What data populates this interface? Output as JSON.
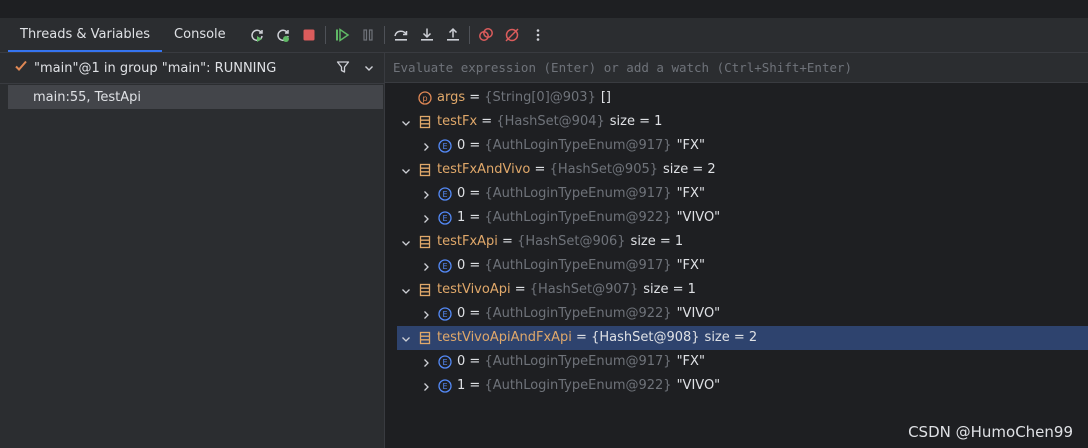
{
  "tabs": [
    {
      "label": "Threads & Variables",
      "active": true
    },
    {
      "label": "Console",
      "active": false
    }
  ],
  "toolbar_icons": [
    "rerun-icon",
    "restart-icon",
    "stop-icon",
    "resume-icon",
    "pause-icon",
    "step-over-icon",
    "step-into-icon",
    "step-out-icon",
    "view-breakpoints-icon",
    "mute-breakpoints-icon",
    "more-icon"
  ],
  "thread": {
    "status_icon": "checkmark-icon",
    "label": "\"main\"@1 in group \"main\": RUNNING"
  },
  "frame": {
    "label": "main:55, TestApi"
  },
  "evaluate": {
    "placeholder": "Evaluate expression (Enter) or add a watch (Ctrl+Shift+Enter)"
  },
  "colors": {
    "accent": "#3574f0",
    "selection": "#2e436e",
    "var_name": "#e0a86a",
    "ref": "#6f737a",
    "stop": "#db5c5c",
    "resume": "#5fb865"
  },
  "variables": [
    {
      "level": 0,
      "expand": "none",
      "icon": "parameter-icon",
      "name": "args",
      "eq": " = ",
      "ref": "{String[0]@903}",
      "value": "[]",
      "size": ""
    },
    {
      "level": 0,
      "expand": "expanded",
      "icon": "field-icon",
      "name": "testFx",
      "eq": " = ",
      "ref": "{HashSet@904}",
      "value": "",
      "size": "size = 1"
    },
    {
      "level": 1,
      "expand": "collapsed",
      "icon": "enum-icon",
      "name": "0",
      "eq": " = ",
      "ref": "{AuthLoginTypeEnum@917}",
      "value": "\"FX\"",
      "size": ""
    },
    {
      "level": 0,
      "expand": "expanded",
      "icon": "field-icon",
      "name": "testFxAndVivo",
      "eq": " = ",
      "ref": "{HashSet@905}",
      "value": "",
      "size": "size = 2"
    },
    {
      "level": 1,
      "expand": "collapsed",
      "icon": "enum-icon",
      "name": "0",
      "eq": " = ",
      "ref": "{AuthLoginTypeEnum@917}",
      "value": "\"FX\"",
      "size": ""
    },
    {
      "level": 1,
      "expand": "collapsed",
      "icon": "enum-icon",
      "name": "1",
      "eq": " = ",
      "ref": "{AuthLoginTypeEnum@922}",
      "value": "\"VIVO\"",
      "size": ""
    },
    {
      "level": 0,
      "expand": "expanded",
      "icon": "field-icon",
      "name": "testFxApi",
      "eq": " = ",
      "ref": "{HashSet@906}",
      "value": "",
      "size": "size = 1"
    },
    {
      "level": 1,
      "expand": "collapsed",
      "icon": "enum-icon",
      "name": "0",
      "eq": " = ",
      "ref": "{AuthLoginTypeEnum@917}",
      "value": "\"FX\"",
      "size": ""
    },
    {
      "level": 0,
      "expand": "expanded",
      "icon": "field-icon",
      "name": "testVivoApi",
      "eq": " = ",
      "ref": "{HashSet@907}",
      "value": "",
      "size": "size = 1"
    },
    {
      "level": 1,
      "expand": "collapsed",
      "icon": "enum-icon",
      "name": "0",
      "eq": " = ",
      "ref": "{AuthLoginTypeEnum@922}",
      "value": "\"VIVO\"",
      "size": ""
    },
    {
      "level": 0,
      "expand": "expanded",
      "icon": "field-icon",
      "name": "testVivoApiAndFxApi",
      "eq": " = ",
      "ref": "{HashSet@908}",
      "value": "",
      "size": "size = 2",
      "selected": true
    },
    {
      "level": 1,
      "expand": "collapsed",
      "icon": "enum-icon",
      "name": "0",
      "eq": " = ",
      "ref": "{AuthLoginTypeEnum@917}",
      "value": "\"FX\"",
      "size": ""
    },
    {
      "level": 1,
      "expand": "collapsed",
      "icon": "enum-icon",
      "name": "1",
      "eq": " = ",
      "ref": "{AuthLoginTypeEnum@922}",
      "value": "\"VIVO\"",
      "size": ""
    }
  ],
  "watermark": "CSDN @HumoChen99"
}
